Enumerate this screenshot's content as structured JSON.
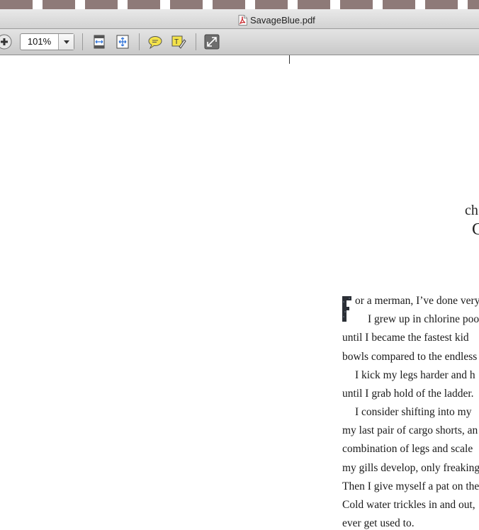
{
  "window": {
    "title": "SavageBlue.pdf"
  },
  "toolbar": {
    "zoom_value": "101%",
    "icons": [
      "zoom-in-icon",
      "fit-page-icon",
      "fit-width-icon",
      "comment-icon",
      "annotate-icon",
      "fullscreen-icon"
    ]
  },
  "document": {
    "heading_fragments": [
      "ch",
      "C"
    ],
    "dropcap": "F",
    "lines": [
      "or a merman, I’ve done very",
      "I grew up in chlorine poo",
      "until I became the fastest kid",
      "bowls compared to the endless",
      "I kick my legs harder and h",
      "until I grab hold of the ladder.",
      "I consider shifting into my",
      "my last pair of cargo shorts, an",
      "combination of legs and scale",
      "my gills develop, only freaking",
      "Then I give myself a pat on the",
      "Cold water trickles in and out,",
      "ever get used to."
    ]
  },
  "colors": {
    "pdf_icon_red": "#c8262b",
    "comment_yellow": "#f3e24a"
  }
}
